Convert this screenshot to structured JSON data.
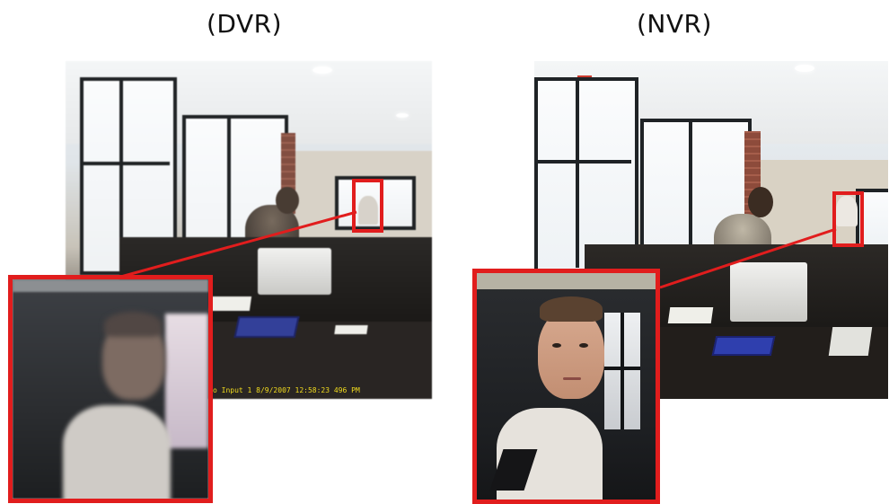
{
  "panels": [
    {
      "id": "dvr",
      "title": "(DVR)",
      "overlay_text": "o Input 1 8/9/2007 12:58:23 496 PM"
    },
    {
      "id": "nvr",
      "title": "(NVR)"
    }
  ],
  "colors": {
    "highlight": "#e11d1d",
    "timestamp": "#f2dc1e",
    "background": "#ffffff"
  }
}
